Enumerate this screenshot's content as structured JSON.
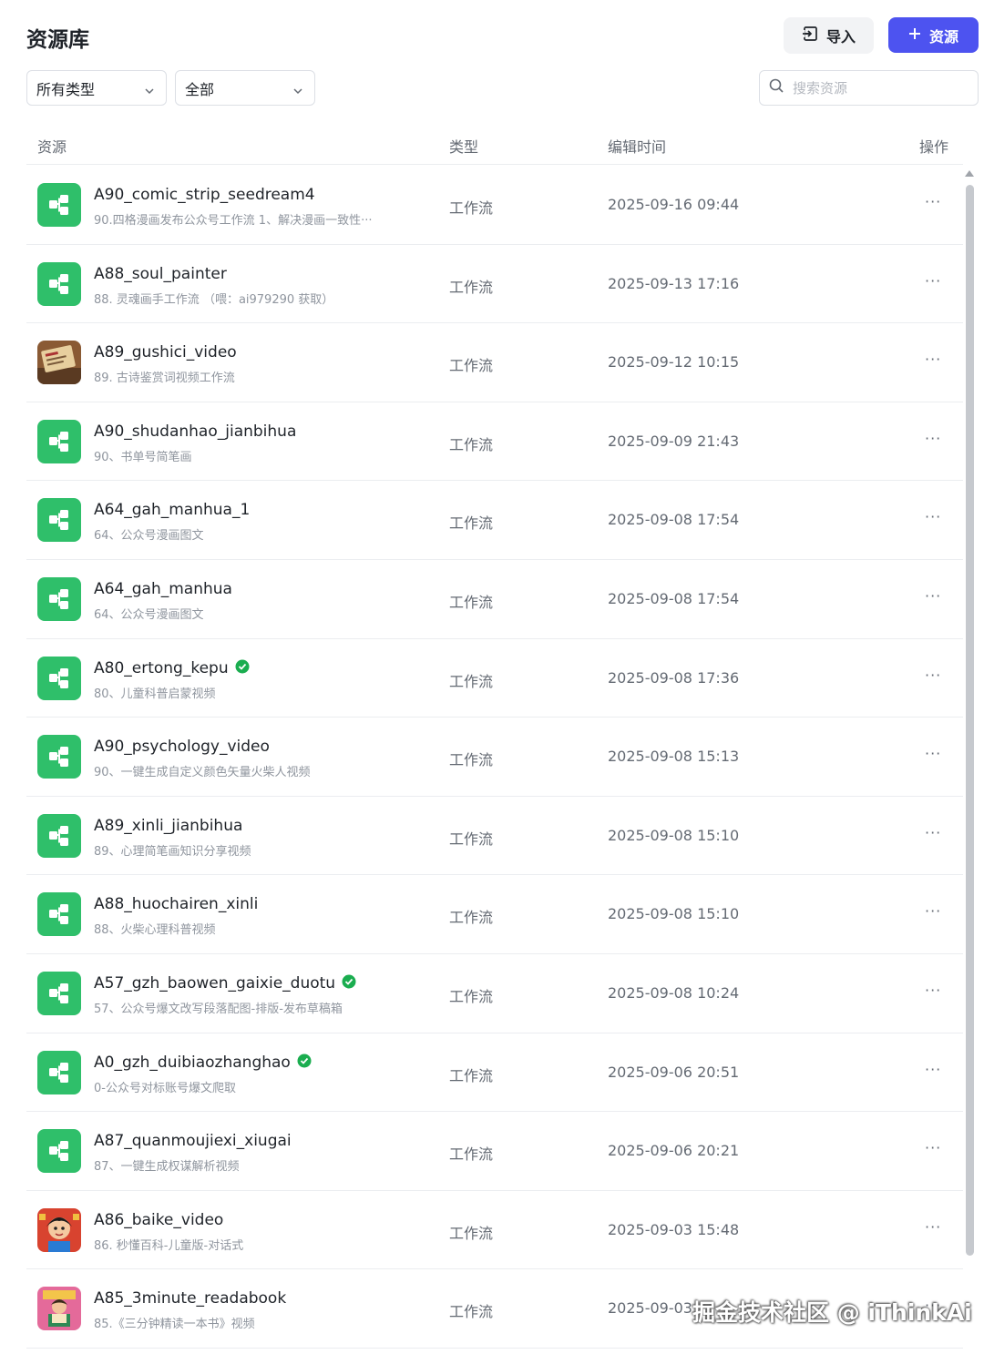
{
  "header": {
    "title": "资源库",
    "import_label": "导入",
    "add_label": "资源"
  },
  "filters": {
    "type_select": "所有类型",
    "scope_select": "全部",
    "search_placeholder": "搜索资源"
  },
  "table": {
    "columns": {
      "resource": "资源",
      "type": "类型",
      "edit_time": "编辑时间",
      "actions": "操作"
    },
    "rows": [
      {
        "name": "A90_comic_strip_seedream4",
        "desc": "90.四格漫画发布公众号工作流 1、解决漫画一致性···",
        "type": "工作流",
        "time": "2025-09-16 09:44",
        "icon": "workflow-icon",
        "verified": false
      },
      {
        "name": "A88_soul_painter",
        "desc": "88. 灵魂画手工作流 （喂：ai979290 获取）",
        "type": "工作流",
        "time": "2025-09-13 17:16",
        "icon": "workflow-icon",
        "verified": false
      },
      {
        "name": "A89_gushici_video",
        "desc": "89. 古诗鉴赏词视频工作流",
        "type": "工作流",
        "time": "2025-09-12 10:15",
        "icon": "book-thumbnail",
        "verified": false
      },
      {
        "name": "A90_shudanhao_jianbihua",
        "desc": "90、书单号简笔画",
        "type": "工作流",
        "time": "2025-09-09 21:43",
        "icon": "workflow-icon",
        "verified": false
      },
      {
        "name": "A64_gah_manhua_1",
        "desc": "64、公众号漫画图文",
        "type": "工作流",
        "time": "2025-09-08 17:54",
        "icon": "workflow-icon",
        "verified": false
      },
      {
        "name": "A64_gah_manhua",
        "desc": "64、公众号漫画图文",
        "type": "工作流",
        "time": "2025-09-08 17:54",
        "icon": "workflow-icon",
        "verified": false
      },
      {
        "name": "A80_ertong_kepu",
        "desc": "80、儿童科普启蒙视频",
        "type": "工作流",
        "time": "2025-09-08 17:36",
        "icon": "workflow-icon",
        "verified": true
      },
      {
        "name": "A90_psychology_video",
        "desc": "90、一键生成自定义颜色矢量火柴人视频",
        "type": "工作流",
        "time": "2025-09-08 15:13",
        "icon": "workflow-icon",
        "verified": false
      },
      {
        "name": "A89_xinli_jianbihua",
        "desc": "89、心理简笔画知识分享视频",
        "type": "工作流",
        "time": "2025-09-08 15:10",
        "icon": "workflow-icon",
        "verified": false
      },
      {
        "name": "A88_huochairen_xinli",
        "desc": "88、火柴心理科普视频",
        "type": "工作流",
        "time": "2025-09-08 15:10",
        "icon": "workflow-icon",
        "verified": false
      },
      {
        "name": "A57_gzh_baowen_gaixie_duotu",
        "desc": "57、公众号爆文改写段落配图-排版-发布草稿箱",
        "type": "工作流",
        "time": "2025-09-08 10:24",
        "icon": "workflow-icon",
        "verified": true
      },
      {
        "name": "A0_gzh_duibiaozhanghao",
        "desc": "0-公众号对标账号爆文爬取",
        "type": "工作流",
        "time": "2025-09-06 20:51",
        "icon": "workflow-icon",
        "verified": true
      },
      {
        "name": "A87_quanmoujiexi_xiugai",
        "desc": "87、一键生成权谋解析视频",
        "type": "工作流",
        "time": "2025-09-06 20:21",
        "icon": "workflow-icon",
        "verified": false
      },
      {
        "name": "A86_baike_video",
        "desc": "86. 秒懂百科-儿童版-对话式",
        "type": "工作流",
        "time": "2025-09-03 15:48",
        "icon": "cartoon-avatar-thumbnail",
        "verified": false
      },
      {
        "name": "A85_3minute_readabook",
        "desc": "85.《三分钟精读一本书》视频",
        "type": "工作流",
        "time": "2025-09-03",
        "icon": "cartoon-reader-thumbnail",
        "verified": false
      }
    ],
    "more_label": "···"
  },
  "watermark": "掘金技术社区 @ iThinkAi",
  "colors": {
    "accent": "#4d53f0",
    "workflow_icon": "#2fbf6a",
    "verified": "#1aad4f"
  }
}
